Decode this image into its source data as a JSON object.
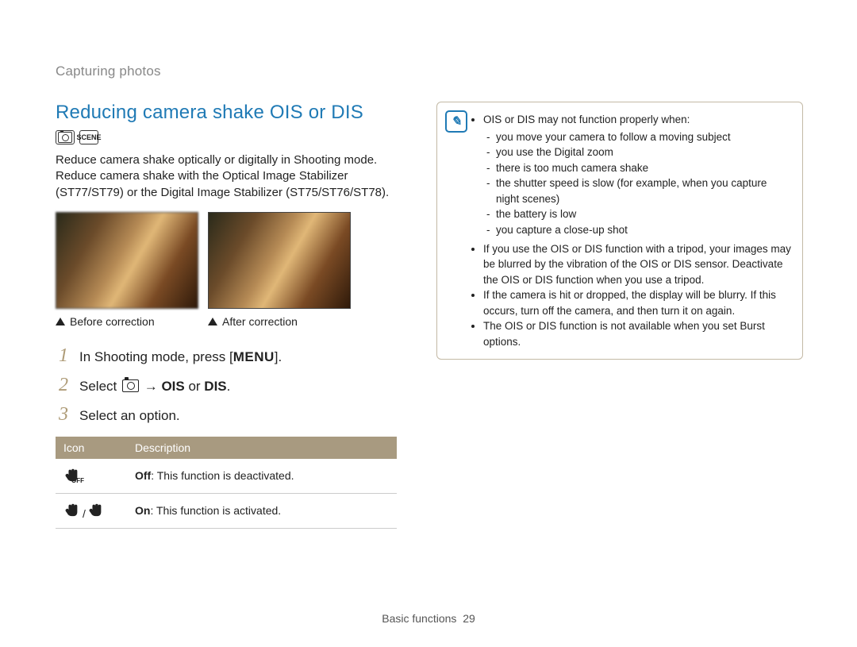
{
  "breadcrumb": "Capturing photos",
  "title": "Reducing camera shake OIS or DIS",
  "mode_icons": [
    "camera-p-icon",
    "scene-icon"
  ],
  "intro": "Reduce camera shake optically or digitally in Shooting mode. Reduce camera shake with the Optical Image Stabilizer (ST77/ST79) or the Digital Image Stabilizer (ST75/ST76/ST78).",
  "samples": {
    "before": "Before correction",
    "after": "After correction"
  },
  "steps": [
    {
      "num": "1",
      "pre": "In Shooting mode, press [",
      "menu": "MENU",
      "post": "]."
    },
    {
      "num": "2",
      "pre": "Select ",
      "select_icon": "camera-icon",
      "arrow": " → ",
      "bold": "OIS",
      "mid": " or ",
      "bold2": "DIS",
      "post": "."
    },
    {
      "num": "3",
      "text": "Select an option."
    }
  ],
  "table": {
    "head_icon": "Icon",
    "head_desc": "Description",
    "rows": [
      {
        "icon": "hand-off-icon",
        "sub": "OFF",
        "bold": "Off",
        "rest": ": This function is deactivated."
      },
      {
        "icon": "hand-ois-dis-icon",
        "sub": "OIS/DIS",
        "bold": "On",
        "rest": ": This function is activated."
      }
    ]
  },
  "note": {
    "lead": "OIS or DIS may not function properly when:",
    "items": [
      "you move your camera to follow a moving subject",
      "you use the Digital zoom",
      "there is too much camera shake",
      "the shutter speed is slow (for example, when you capture night scenes)",
      "the battery is low",
      "you capture a close-up shot"
    ],
    "bullets": [
      "If you use the OIS or DIS function with a tripod, your images may be blurred by the vibration of the OIS or DIS sensor. Deactivate the OIS or DIS function when you use a tripod.",
      "If the camera is hit or dropped, the display will be blurry. If this occurs, turn off the camera, and then turn it on again.",
      "The OIS or DIS function is not available when you set Burst options."
    ]
  },
  "footer": {
    "section": "Basic functions",
    "page": "29"
  }
}
